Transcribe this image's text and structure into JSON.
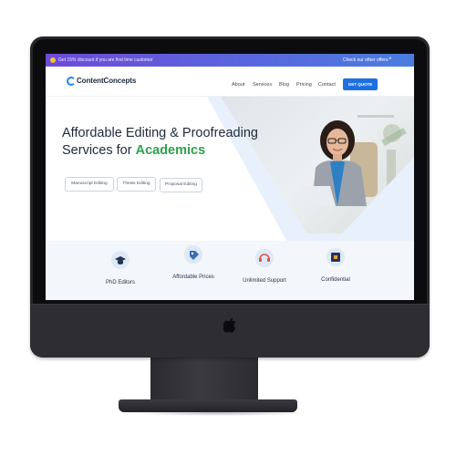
{
  "promo_bar": {
    "message": "Get 15% discount if you are first time customer",
    "cta": "Check our other offers",
    "close": "×"
  },
  "header": {
    "logo": "ContentConcepts",
    "nav": [
      "About",
      "Services",
      "Blog",
      "Pricing",
      "Contact"
    ],
    "quote_button": "GET QUOTE"
  },
  "hero": {
    "title_line1": "Affordable Editing & Proofreading",
    "title_line2_prefix": "Services for ",
    "title_line2_accent": "Academics",
    "services": [
      "Manuscript Editing",
      "Thesis Editing",
      "Proposal Editing"
    ]
  },
  "features": [
    {
      "label": "PhD Editors",
      "icon": "graduation-cap-icon"
    },
    {
      "label": "Affordable Prices",
      "icon": "price-tag-icon"
    },
    {
      "label": "Unlimited Support",
      "icon": "headset-icon"
    },
    {
      "label": "Confidential",
      "icon": "lock-icon"
    }
  ],
  "colors": {
    "promo_gradient_start": "#6d4bd8",
    "promo_gradient_end": "#4a7de0",
    "brand_blue": "#1f6fe0",
    "accent_green": "#2fa04e",
    "feature_band": "#f3f6fb"
  }
}
